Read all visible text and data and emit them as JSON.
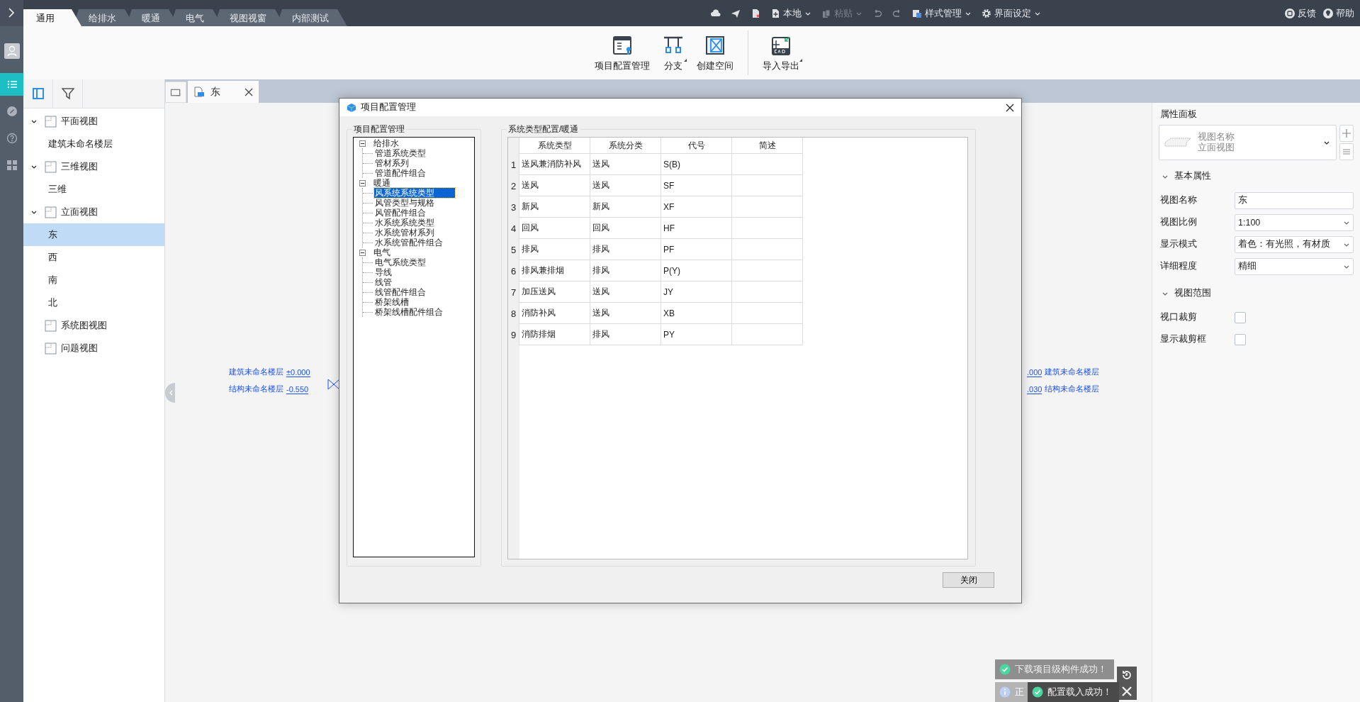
{
  "menu_tabs": [
    {
      "label": "通用",
      "selected": true
    },
    {
      "label": "给排水",
      "selected": false
    },
    {
      "label": "暖通",
      "selected": false
    },
    {
      "label": "电气",
      "selected": false
    },
    {
      "label": "视图视窗",
      "selected": false
    },
    {
      "label": "内部测试",
      "selected": false
    }
  ],
  "quick_tools": [
    {
      "label": "本地",
      "disabled": false
    },
    {
      "label": "粘贴",
      "disabled": true
    },
    {
      "label": "样式管理",
      "disabled": false
    },
    {
      "label": "界面设定",
      "disabled": false
    }
  ],
  "help_links": [
    "反馈",
    "帮助"
  ],
  "ribbon": [
    {
      "label": "项目配置管理",
      "has_menu": false,
      "separator_before": false
    },
    {
      "label": "分支",
      "has_menu": true,
      "separator_before": false
    },
    {
      "label": "创建空间",
      "has_menu": false,
      "separator_before": false
    },
    {
      "label": "导入导出",
      "has_menu": true,
      "separator_before": true
    }
  ],
  "rail_items": [
    {
      "selected": true
    },
    {
      "selected": false
    },
    {
      "selected": false
    },
    {
      "selected": false
    }
  ],
  "panel_tabs": [
    {
      "selected": true
    },
    {
      "selected": false
    }
  ],
  "view_tree": [
    {
      "label": "平面视图",
      "expanded": true,
      "selected": false,
      "children": [
        {
          "label": "建筑未命名楼层",
          "selected": false
        }
      ]
    },
    {
      "label": "三维视图",
      "expanded": true,
      "selected": false,
      "children": [
        {
          "label": "三维",
          "selected": false
        }
      ]
    },
    {
      "label": "立面视图",
      "expanded": true,
      "selected": false,
      "children": [
        {
          "label": "东",
          "selected": true
        },
        {
          "label": "西",
          "selected": false
        },
        {
          "label": "南",
          "selected": false
        },
        {
          "label": "北",
          "selected": false
        }
      ]
    },
    {
      "label": "系统图视图",
      "selected": false
    },
    {
      "label": "问题视图",
      "selected": false
    }
  ],
  "doc_tabs": [
    {
      "label": "东",
      "selected": true
    }
  ],
  "level_marks": [
    {
      "kind": "left",
      "name": "建筑未命名楼层",
      "value": "±0.000"
    },
    {
      "kind": "left",
      "name": "结构未命名楼层",
      "value": "-0.550"
    },
    {
      "kind": "right",
      "name": "建筑未命名楼层",
      "value": ".000"
    },
    {
      "kind": "right",
      "name": "结构未命名楼层",
      "value": ".030"
    }
  ],
  "dialog": {
    "title": "项目配置管理",
    "tree_group": "项目配置管理",
    "tree": [
      {
        "label": "给排水",
        "expanded": true,
        "selected": false,
        "children": [
          {
            "label": "管道系统类型",
            "selected": false
          },
          {
            "label": "管材系列",
            "selected": false
          },
          {
            "label": "管道配件组合",
            "selected": false
          }
        ]
      },
      {
        "label": "暖通",
        "expanded": true,
        "selected": false,
        "children": [
          {
            "label": "风系统系统类型",
            "selected": true
          },
          {
            "label": "风管类型与规格",
            "selected": false
          },
          {
            "label": "风管配件组合",
            "selected": false
          },
          {
            "label": "水系统系统类型",
            "selected": false
          },
          {
            "label": "水系统管材系列",
            "selected": false
          },
          {
            "label": "水系统管配件组合",
            "selected": false
          }
        ]
      },
      {
        "label": "电气",
        "expanded": true,
        "selected": false,
        "children": [
          {
            "label": "电气系统类型",
            "selected": false
          },
          {
            "label": "导线",
            "selected": false
          },
          {
            "label": "线管",
            "selected": false
          },
          {
            "label": "线管配件组合",
            "selected": false
          },
          {
            "label": "桥架线槽",
            "selected": false
          },
          {
            "label": "桥架线槽配件组合",
            "selected": false
          }
        ]
      }
    ],
    "table_group": "系统类型配置/暖通",
    "columns": [
      "系统类型",
      "系统分类",
      "代号",
      "简述"
    ],
    "rows": [
      {
        "index": "1",
        "type": "送风兼消防补风",
        "category": "送风",
        "code": "S(B)"
      },
      {
        "index": "2",
        "type": "送风",
        "category": "送风",
        "code": "SF"
      },
      {
        "index": "3",
        "type": "新风",
        "category": "新风",
        "code": "XF"
      },
      {
        "index": "4",
        "type": "回风",
        "category": "回风",
        "code": "HF"
      },
      {
        "index": "5",
        "type": "排风",
        "category": "排风",
        "code": "PF"
      },
      {
        "index": "6",
        "type": "排风兼排烟",
        "category": "排风",
        "code": "P(Y)"
      },
      {
        "index": "7",
        "type": "加压送风",
        "category": "送风",
        "code": "JY"
      },
      {
        "index": "8",
        "type": "消防补风",
        "category": "送风",
        "code": "XB"
      },
      {
        "index": "9",
        "type": "消防排烟",
        "category": "排风",
        "code": "PY"
      }
    ],
    "close_button": "关闭"
  },
  "properties": {
    "title": "属性面板",
    "type_selector": {
      "name": "视图名称",
      "type": "立面视图"
    },
    "sections": [
      {
        "label": "基本属性",
        "expanded": true,
        "fields": [
          {
            "kind": "text",
            "label": "视图名称",
            "value": "东"
          },
          {
            "kind": "select",
            "label": "视图比例",
            "value": "1:100"
          },
          {
            "kind": "select",
            "label": "显示模式",
            "value": "着色：有光照，有材质"
          },
          {
            "kind": "select",
            "label": "详细程度",
            "value": "精细"
          }
        ]
      },
      {
        "label": "视图范围",
        "expanded": true,
        "fields": [
          {
            "kind": "checkbox",
            "label": "视口裁剪",
            "checked": false
          },
          {
            "kind": "checkbox",
            "label": "显示裁剪框",
            "checked": false
          }
        ]
      }
    ]
  },
  "toasts": [
    {
      "kind": "success",
      "text": "下载项目级构件成功！"
    },
    {
      "kind": "info",
      "text": "正"
    },
    {
      "kind": "success",
      "text": "配置载入成功！"
    }
  ]
}
